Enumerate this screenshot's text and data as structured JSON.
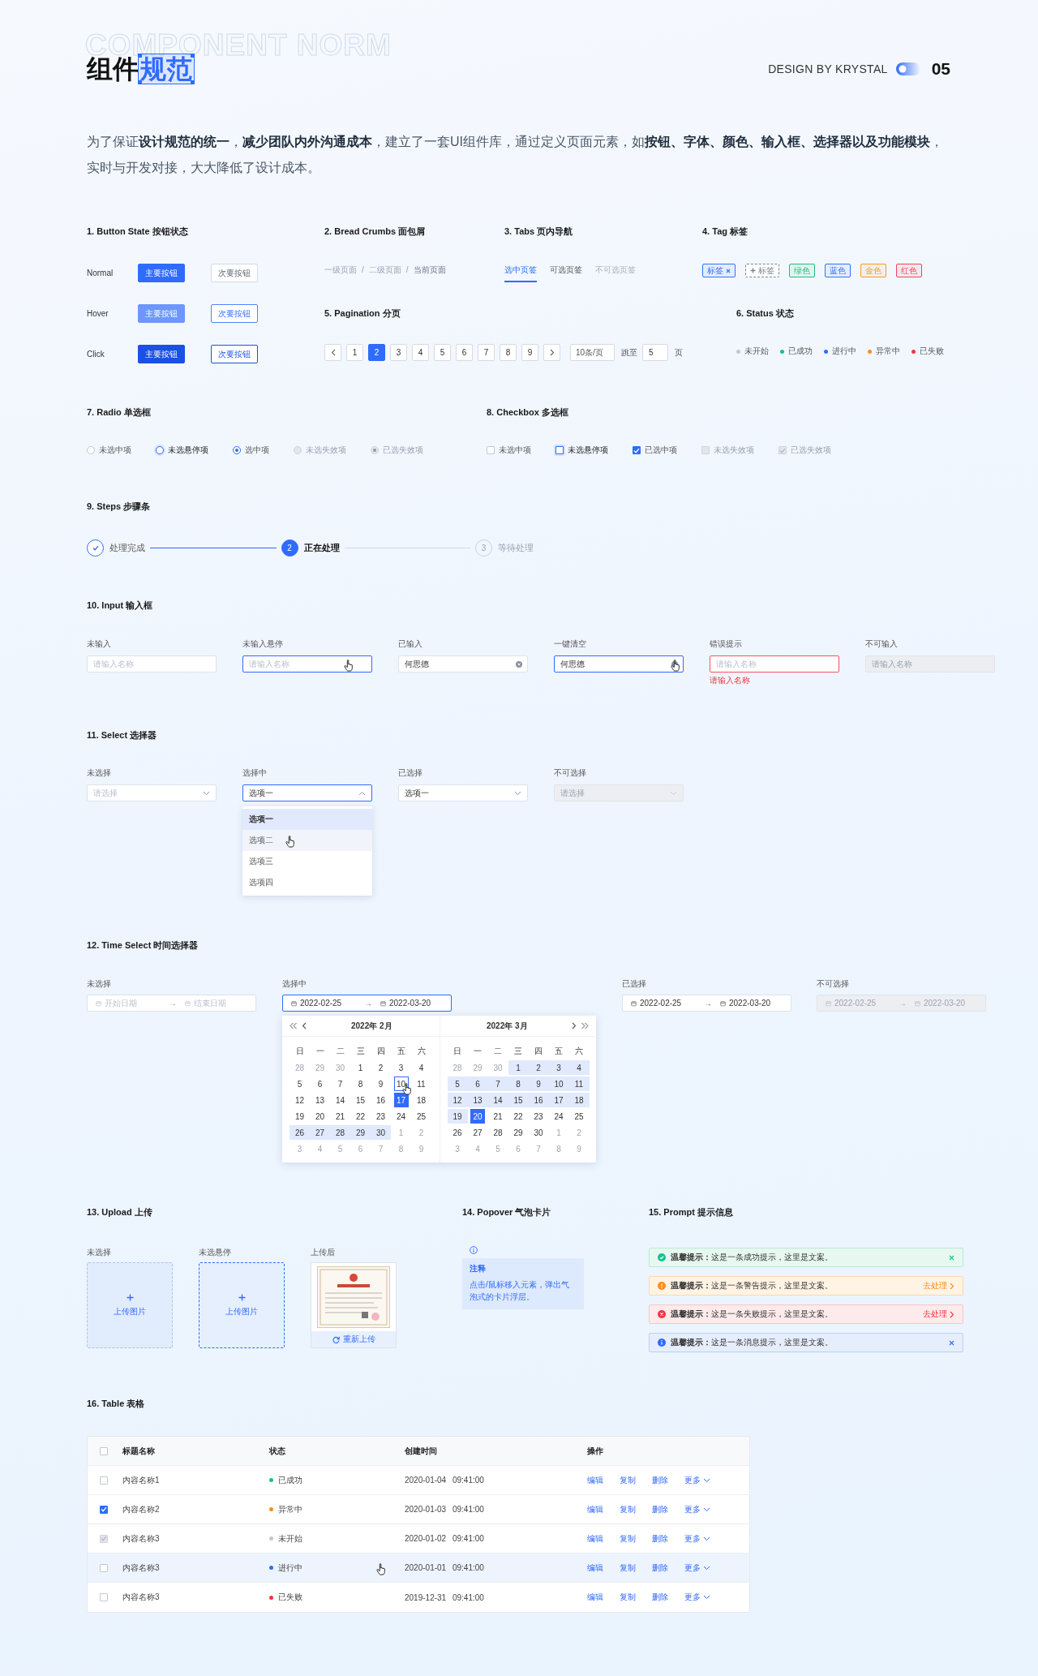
{
  "header": {
    "watermark": "COMPONENT NORM",
    "title": "组件",
    "title_highlight": "规范",
    "credit": "DESIGN BY KRYSTAL",
    "page_number": "05"
  },
  "intro": "为了保证**设计规范的统一**，**减少团队内外沟通成本**，建立了一套UI组件库，通过定义页面元素，如**按钮、字体、颜色、输入框、选择器以及功能模块**，实时与开发对接，大大降低了设计成本。",
  "buttons": {
    "title": "1. Button State 按钮状态",
    "rows": [
      {
        "label": "Normal",
        "hover": false,
        "pressed": false,
        "primary": "主要按钮",
        "secondary": "次要按钮"
      },
      {
        "label": "Hover",
        "hover": true,
        "pressed": false,
        "primary": "主要按钮",
        "secondary": "次要按钮"
      },
      {
        "label": "Click",
        "hover": false,
        "pressed": true,
        "primary": "主要按钮",
        "secondary": "次要按钮"
      }
    ]
  },
  "breadcrumb": {
    "title": "2. Bread Crumbs 面包屑",
    "items": [
      {
        "label": "一级页面",
        "current": false
      },
      {
        "label": "二级页面",
        "current": false
      },
      {
        "label": "当前页面",
        "current": true
      }
    ],
    "separators": [
      "/",
      "/"
    ]
  },
  "tabs": {
    "title": "3. Tabs 页内导航",
    "items": [
      {
        "label": "选中页签",
        "selected": true,
        "disabled": false
      },
      {
        "label": "可选页签",
        "selected": false,
        "disabled": false
      },
      {
        "label": "不可选页签",
        "selected": false,
        "disabled": true
      }
    ]
  },
  "tags": {
    "title": "4. Tag 标签",
    "items": [
      {
        "label": "标签",
        "kind": "closable",
        "color": "#3370ff"
      },
      {
        "label": "标签",
        "kind": "add",
        "color": "#7a8496"
      },
      {
        "label": "绿色",
        "kind": "plain",
        "color": "#1fbf75"
      },
      {
        "label": "蓝色",
        "kind": "plain",
        "color": "#3370ff"
      },
      {
        "label": "金色",
        "kind": "plain",
        "color": "#f79a1b"
      },
      {
        "label": "红色",
        "kind": "plain",
        "color": "#f2454e"
      }
    ]
  },
  "pagination": {
    "title": "5. Pagination 分页",
    "pages": [
      {
        "label": "1",
        "selected": false
      },
      {
        "label": "2",
        "selected": true
      },
      {
        "label": "3",
        "selected": false
      },
      {
        "label": "4",
        "selected": false
      },
      {
        "label": "5",
        "selected": false
      },
      {
        "label": "6",
        "selected": false
      },
      {
        "label": "7",
        "selected": false
      },
      {
        "label": "8",
        "selected": false
      },
      {
        "label": "9",
        "selected": false
      }
    ],
    "page_size": "10条/页",
    "jump_label": "跳至",
    "jump_value": "5",
    "page_unit": "页"
  },
  "status": {
    "title": "6. Status 状态",
    "items": [
      {
        "label": "未开始",
        "color": "#c3c7cf"
      },
      {
        "label": "已成功",
        "color": "#14c38e"
      },
      {
        "label": "进行中",
        "color": "#2f6bff"
      },
      {
        "label": "异常中",
        "color": "#ff8d1a"
      },
      {
        "label": "已失败",
        "color": "#f5333f"
      }
    ]
  },
  "radio": {
    "title": "7. Radio 单选框",
    "items": [
      {
        "label": "未选中项",
        "checked": false,
        "hover": false,
        "disabled": false
      },
      {
        "label": "未选悬停项",
        "checked": false,
        "hover": true,
        "disabled": false
      },
      {
        "label": "选中项",
        "checked": true,
        "hover": false,
        "disabled": false
      },
      {
        "label": "未选失效项",
        "checked": false,
        "hover": false,
        "disabled": true
      },
      {
        "label": "已选失效项",
        "checked": true,
        "hover": false,
        "disabled": true
      }
    ]
  },
  "checkbox": {
    "title": "8. Checkbox 多选框",
    "items": [
      {
        "label": "未选中项",
        "checked": false,
        "hover": false,
        "disabled": false
      },
      {
        "label": "未选悬停项",
        "checked": false,
        "hover": true,
        "disabled": false
      },
      {
        "label": "已选中项",
        "checked": true,
        "hover": false,
        "disabled": false
      },
      {
        "label": "未选失效项",
        "checked": false,
        "hover": false,
        "disabled": true
      },
      {
        "label": "已选失效项",
        "checked": true,
        "hover": false,
        "disabled": true
      }
    ]
  },
  "steps": {
    "title": "9. Steps 步骤条",
    "items": [
      {
        "label": "处理完成",
        "completed": true,
        "active": false
      },
      {
        "label": "正在处理",
        "completed": false,
        "active": true,
        "number": "2"
      },
      {
        "label": "等待处理",
        "completed": false,
        "active": false,
        "number": "3"
      }
    ]
  },
  "inputs": {
    "title": "10. Input 输入框",
    "items": [
      {
        "label": "未输入",
        "placeholder": "请输入名称",
        "hover": false,
        "disabled": false,
        "pointer": false,
        "clearable": false
      },
      {
        "label": "未输入悬停",
        "placeholder": "请输入名称",
        "hover": true,
        "disabled": false,
        "pointer": true,
        "clearable": false
      },
      {
        "label": "已输入",
        "value": "何思德",
        "hover": false,
        "disabled": false,
        "pointer": false,
        "clearable": true
      },
      {
        "label": "一键清空",
        "value": "何思德",
        "hover": true,
        "disabled": false,
        "pointer": true,
        "clearable": true
      },
      {
        "label": "错误提示",
        "placeholder": "请输入名称",
        "hover": false,
        "disabled": false,
        "pointer": false,
        "clearable": false,
        "error": "请输入名称"
      },
      {
        "label": "不可输入",
        "placeholder": "请输入名称",
        "hover": false,
        "disabled": true,
        "pointer": false,
        "clearable": false
      }
    ]
  },
  "selects": {
    "title": "11. Select 选择器",
    "items": [
      {
        "label": "未选择",
        "placeholder": "请选择",
        "open": false,
        "disabled": false
      },
      {
        "label": "选择中",
        "value": "选项一",
        "open": true,
        "disabled": false,
        "options": [
          {
            "label": "选项一",
            "selected": true,
            "hover": false,
            "pointer": false
          },
          {
            "label": "选项二",
            "selected": false,
            "hover": true,
            "pointer": true
          },
          {
            "label": "选项三",
            "selected": false,
            "hover": false,
            "pointer": false
          },
          {
            "label": "选项四",
            "selected": false,
            "hover": false,
            "pointer": false
          }
        ]
      },
      {
        "label": "已选择",
        "value": "选项一",
        "open": false,
        "disabled": false
      },
      {
        "label": "不可选择",
        "placeholder": "请选择",
        "open": false,
        "disabled": true
      }
    ]
  },
  "date_pickers": {
    "title": "12. Time Select 时间选择器",
    "items": [
      {
        "label": "未选择",
        "start_placeholder": "开始日期",
        "end_placeholder": "结束日期",
        "arrow": "→",
        "open": false,
        "disabled": false
      },
      {
        "label": "选择中",
        "start": "2022-02-25",
        "end": "2022-03-20",
        "arrow": "→",
        "open": true,
        "disabled": false,
        "panels": [
          {
            "title": "2022年 2月",
            "weekdays": [
              "日",
              "一",
              "二",
              "三",
              "四",
              "五",
              "六"
            ],
            "weeks": [
              [
                {
                  "day": "28",
                  "kind": "muted"
                },
                {
                  "day": "29",
                  "kind": "muted"
                },
                {
                  "day": "30",
                  "kind": "muted"
                },
                {
                  "day": "1",
                  "kind": "normal"
                },
                {
                  "day": "2",
                  "kind": "normal"
                },
                {
                  "day": "3",
                  "kind": "normal"
                },
                {
                  "day": "4",
                  "kind": "normal"
                }
              ],
              [
                {
                  "day": "5",
                  "kind": "normal"
                },
                {
                  "day": "6",
                  "kind": "normal"
                },
                {
                  "day": "7",
                  "kind": "normal"
                },
                {
                  "day": "8",
                  "kind": "normal"
                },
                {
                  "day": "9",
                  "kind": "normal"
                },
                {
                  "day": "10",
                  "kind": "hover",
                  "pointer": true
                },
                {
                  "day": "11",
                  "kind": "normal"
                }
              ],
              [
                {
                  "day": "12",
                  "kind": "normal"
                },
                {
                  "day": "13",
                  "kind": "normal"
                },
                {
                  "day": "14",
                  "kind": "normal"
                },
                {
                  "day": "15",
                  "kind": "normal"
                },
                {
                  "day": "16",
                  "kind": "normal"
                },
                {
                  "day": "17",
                  "kind": "selected"
                },
                {
                  "day": "18",
                  "kind": "normal"
                }
              ],
              [
                {
                  "day": "19",
                  "kind": "normal"
                },
                {
                  "day": "20",
                  "kind": "normal"
                },
                {
                  "day": "21",
                  "kind": "normal"
                },
                {
                  "day": "22",
                  "kind": "normal"
                },
                {
                  "day": "23",
                  "kind": "normal"
                },
                {
                  "day": "24",
                  "kind": "normal"
                },
                {
                  "day": "25",
                  "kind": "normal"
                }
              ],
              [
                {
                  "day": "26",
                  "kind": "range"
                },
                {
                  "day": "27",
                  "kind": "range"
                },
                {
                  "day": "28",
                  "kind": "range"
                },
                {
                  "day": "29",
                  "kind": "range"
                },
                {
                  "day": "30",
                  "kind": "range"
                },
                {
                  "day": "1",
                  "kind": "muted"
                },
                {
                  "day": "2",
                  "kind": "muted"
                }
              ],
              [
                {
                  "day": "3",
                  "kind": "muted"
                },
                {
                  "day": "4",
                  "kind": "muted"
                },
                {
                  "day": "5",
                  "kind": "muted"
                },
                {
                  "day": "6",
                  "kind": "muted"
                },
                {
                  "day": "7",
                  "kind": "muted"
                },
                {
                  "day": "8",
                  "kind": "muted"
                },
                {
                  "day": "9",
                  "kind": "muted"
                }
              ]
            ]
          },
          {
            "title": "2022年 3月",
            "weekdays": [
              "日",
              "一",
              "二",
              "三",
              "四",
              "五",
              "六"
            ],
            "weeks": [
              [
                {
                  "day": "28",
                  "kind": "muted"
                },
                {
                  "day": "29",
                  "kind": "muted"
                },
                {
                  "day": "30",
                  "kind": "muted"
                },
                {
                  "day": "1",
                  "kind": "range"
                },
                {
                  "day": "2",
                  "kind": "range"
                },
                {
                  "day": "3",
                  "kind": "range"
                },
                {
                  "day": "4",
                  "kind": "range"
                }
              ],
              [
                {
                  "day": "5",
                  "kind": "range"
                },
                {
                  "day": "6",
                  "kind": "range"
                },
                {
                  "day": "7",
                  "kind": "range"
                },
                {
                  "day": "8",
                  "kind": "range"
                },
                {
                  "day": "9",
                  "kind": "range"
                },
                {
                  "day": "10",
                  "kind": "range"
                },
                {
                  "day": "11",
                  "kind": "range"
                }
              ],
              [
                {
                  "day": "12",
                  "kind": "range"
                },
                {
                  "day": "13",
                  "kind": "range"
                },
                {
                  "day": "14",
                  "kind": "range"
                },
                {
                  "day": "15",
                  "kind": "range"
                },
                {
                  "day": "16",
                  "kind": "range"
                },
                {
                  "day": "17",
                  "kind": "range"
                },
                {
                  "day": "18",
                  "kind": "range"
                }
              ],
              [
                {
                  "day": "19",
                  "kind": "range"
                },
                {
                  "day": "20",
                  "kind": "selected"
                },
                {
                  "day": "21",
                  "kind": "normal"
                },
                {
                  "day": "22",
                  "kind": "normal"
                },
                {
                  "day": "23",
                  "kind": "normal"
                },
                {
                  "day": "24",
                  "kind": "normal"
                },
                {
                  "day": "25",
                  "kind": "normal"
                }
              ],
              [
                {
                  "day": "26",
                  "kind": "normal"
                },
                {
                  "day": "27",
                  "kind": "normal"
                },
                {
                  "day": "28",
                  "kind": "normal"
                },
                {
                  "day": "29",
                  "kind": "normal"
                },
                {
                  "day": "30",
                  "kind": "normal"
                },
                {
                  "day": "1",
                  "kind": "muted"
                },
                {
                  "day": "2",
                  "kind": "muted"
                }
              ],
              [
                {
                  "day": "3",
                  "kind": "muted"
                },
                {
                  "day": "4",
                  "kind": "muted"
                },
                {
                  "day": "5",
                  "kind": "muted"
                },
                {
                  "day": "6",
                  "kind": "muted"
                },
                {
                  "day": "7",
                  "kind": "muted"
                },
                {
                  "day": "8",
                  "kind": "muted"
                },
                {
                  "day": "9",
                  "kind": "muted"
                }
              ]
            ]
          }
        ]
      },
      {
        "label": "已选择",
        "start": "2022-02-25",
        "end": "2022-03-20",
        "arrow": "→",
        "open": false,
        "disabled": false
      },
      {
        "label": "不可选择",
        "start": "2022-02-25",
        "end": "2022-03-20",
        "arrow": "→",
        "open": false,
        "disabled": true
      }
    ]
  },
  "uploads": {
    "title": "13. Upload 上传",
    "items": [
      {
        "label": "未选择",
        "kind": "empty",
        "hover": false,
        "text": "上传图片"
      },
      {
        "label": "未选悬停",
        "kind": "empty",
        "hover": true,
        "text": "上传图片"
      },
      {
        "label": "上传后",
        "kind": "uploaded",
        "text": "重新上传"
      }
    ]
  },
  "popover": {
    "title": "14. Popover 气泡卡片",
    "heading": "注释",
    "body": "点击/鼠标移入元素，弹出气泡式的卡片浮层。"
  },
  "prompts": {
    "title": "15. Prompt 提示信息",
    "items": [
      {
        "kind": "success",
        "message": "**温馨提示：**这是一条成功提示，这里是文案。"
      },
      {
        "kind": "warning",
        "message": "**温馨提示：**这是一条警告提示，这里是文案。",
        "action": "去处理"
      },
      {
        "kind": "error",
        "message": "**温馨提示：**这是一条失败提示，这里是文案。",
        "action": "去处理"
      },
      {
        "kind": "info",
        "message": "**温馨提示：**这是一条消息提示，这里是文案。"
      }
    ]
  },
  "table": {
    "title": "16. Table 表格",
    "select_all": {
      "checked": false
    },
    "columns": [
      "标题名称",
      "状态",
      "创建时间",
      "操作"
    ],
    "rows": [
      {
        "name": "内容名称1",
        "status": "已成功",
        "color": "#14c38e",
        "time": "2020-01-04 09:41:00",
        "checked": false,
        "disabled": false,
        "hover": false,
        "actions": [
          "编辑",
          "复制",
          "删除"
        ],
        "more": "更多"
      },
      {
        "name": "内容名称2",
        "status": "异常中",
        "color": "#ff8d1a",
        "time": "2020-01-03 09:41:00",
        "checked": true,
        "disabled": false,
        "hover": false,
        "actions": [
          "编辑",
          "复制",
          "删除"
        ],
        "more": "更多"
      },
      {
        "name": "内容名称3",
        "status": "未开始",
        "color": "#c3c7cf",
        "time": "2020-01-02 09:41:00",
        "checked": true,
        "disabled": true,
        "hover": false,
        "actions": [
          "编辑",
          "复制",
          "删除"
        ],
        "more": "更多"
      },
      {
        "name": "内容名称3",
        "status": "进行中",
        "color": "#2f6bff",
        "time": "2020-01-01 09:41:00",
        "checked": false,
        "disabled": false,
        "hover": true,
        "actions": [
          "编辑",
          "复制",
          "删除"
        ],
        "more": "更多"
      },
      {
        "name": "内容名称3",
        "status": "已失败",
        "color": "#f5333f",
        "time": "2019-12-31 09:41:00",
        "checked": false,
        "disabled": false,
        "hover": false,
        "actions": [
          "编辑",
          "复制",
          "删除"
        ],
        "more": "更多"
      }
    ]
  }
}
